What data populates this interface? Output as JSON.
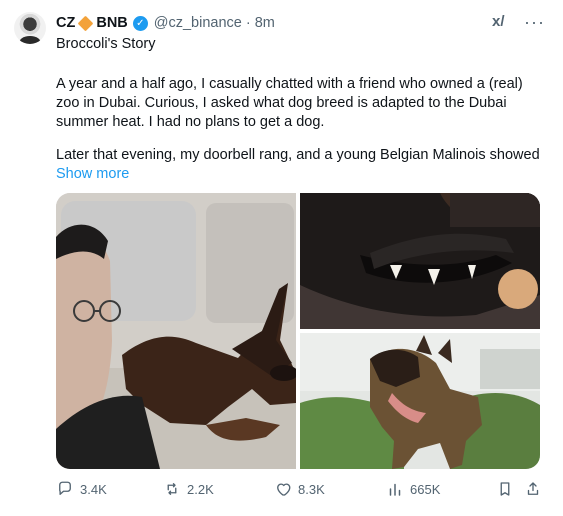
{
  "post": {
    "author_name": "CZ",
    "badge_text": "BNB",
    "handle": "@cz_binance",
    "separator": "·",
    "time": "8m",
    "title": "Broccoli's Story",
    "paragraphs": [
      "A year and a half ago, I casually chatted with a friend who owned a (real) zoo in Dubai. Curious, I asked what dog breed is adapted to the Dubai summer heat. I had no plans to get a dog.",
      "Later that evening, my doorbell rang, and a young Belgian Malinois showed"
    ],
    "show_more": "Show more"
  },
  "actions": {
    "replies": "3.4K",
    "reposts": "2.2K",
    "likes": "8.3K",
    "views": "665K"
  },
  "icons": {
    "more": "more-icon",
    "grok": "grok-icon",
    "verified": "verified-icon"
  },
  "colors": {
    "accent": "#1d9bf0",
    "muted": "#536471",
    "text": "#0f1419",
    "badge": "#f3a23a"
  }
}
